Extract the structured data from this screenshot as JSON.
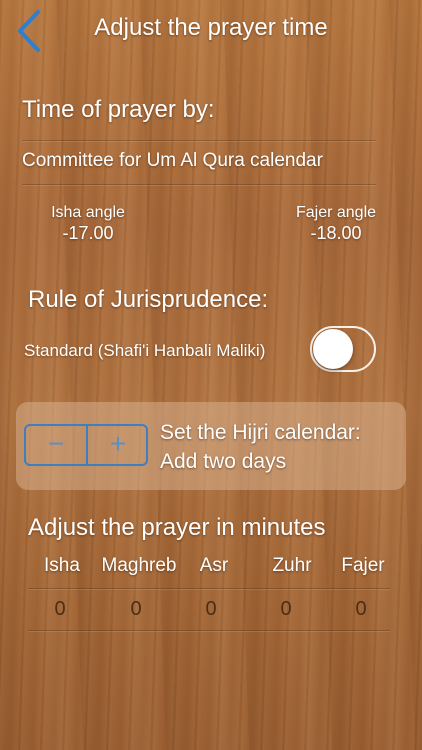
{
  "header": {
    "title": "Adjust the prayer time"
  },
  "time_of_prayer": {
    "heading": "Time of prayer by:",
    "method": "Committee for Um Al Qura calendar",
    "isha_label": "Isha angle",
    "isha_value": "-17.00",
    "fajer_label": "Fajer angle",
    "fajer_value": "-18.00"
  },
  "jurisprudence": {
    "heading": "Rule of Jurisprudence:",
    "label": "Standard (Shafi'i Hanbali Maliki)",
    "toggle_on": false
  },
  "hijri": {
    "minus": "−",
    "plus": "+",
    "line1": "Set the Hijri calendar:",
    "line2": "Add two days"
  },
  "adjust": {
    "heading": "Adjust the prayer in minutes",
    "columns": [
      {
        "label": "Isha",
        "value": "0"
      },
      {
        "label": "Maghreb",
        "value": "0"
      },
      {
        "label": "Asr",
        "value": "0"
      },
      {
        "label": "Zuhr",
        "value": "0"
      },
      {
        "label": "Fajer",
        "value": "0"
      }
    ]
  },
  "colors": {
    "accent": "#3f7fc0",
    "wood": "#a8693a"
  }
}
